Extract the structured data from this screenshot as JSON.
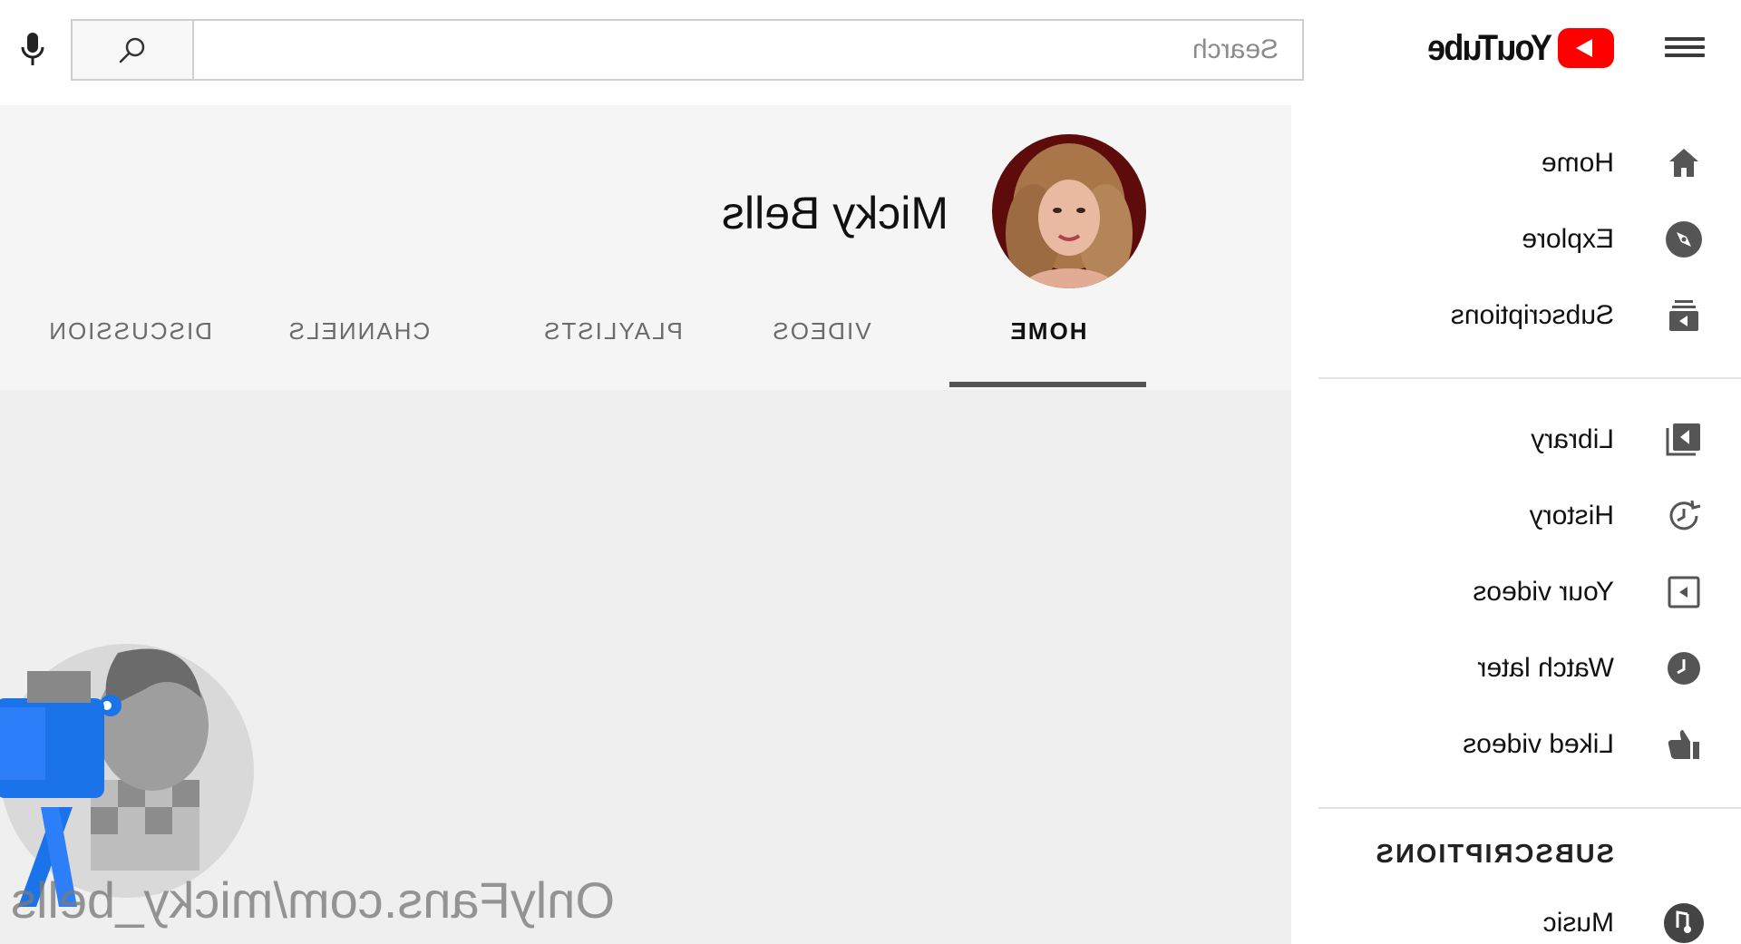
{
  "header": {
    "logo_text": "YouTube",
    "search_placeholder": "Search"
  },
  "sidebar": {
    "items": [
      {
        "label": "Home",
        "icon": "home-icon"
      },
      {
        "label": "Explore",
        "icon": "compass-icon"
      },
      {
        "label": "Subscriptions",
        "icon": "subscriptions-icon"
      },
      {
        "label": "Library",
        "icon": "library-icon"
      },
      {
        "label": "History",
        "icon": "history-icon"
      },
      {
        "label": "Your videos",
        "icon": "your-videos-icon"
      },
      {
        "label": "Watch later",
        "icon": "clock-icon"
      },
      {
        "label": "Liked videos",
        "icon": "thumbs-up-icon"
      }
    ],
    "subscriptions_heading": "SUBSCRIPTIONS",
    "subscriptions": [
      {
        "label": "Music",
        "icon": "music-icon"
      }
    ]
  },
  "channel": {
    "name": "Micky Bells",
    "tabs": [
      {
        "label": "HOME",
        "active": true
      },
      {
        "label": "VIDEOS",
        "active": false
      },
      {
        "label": "PLAYLISTS",
        "active": false
      },
      {
        "label": "CHANNELS",
        "active": false
      },
      {
        "label": "DISCUSSION",
        "active": false
      }
    ]
  },
  "watermark": "OnlyFans.com/micky_bells",
  "colors": {
    "brand_red": "#ff0000",
    "header_bg": "#f5f5f5",
    "body_bg": "#efefef",
    "tab_indicator": "#555555"
  }
}
